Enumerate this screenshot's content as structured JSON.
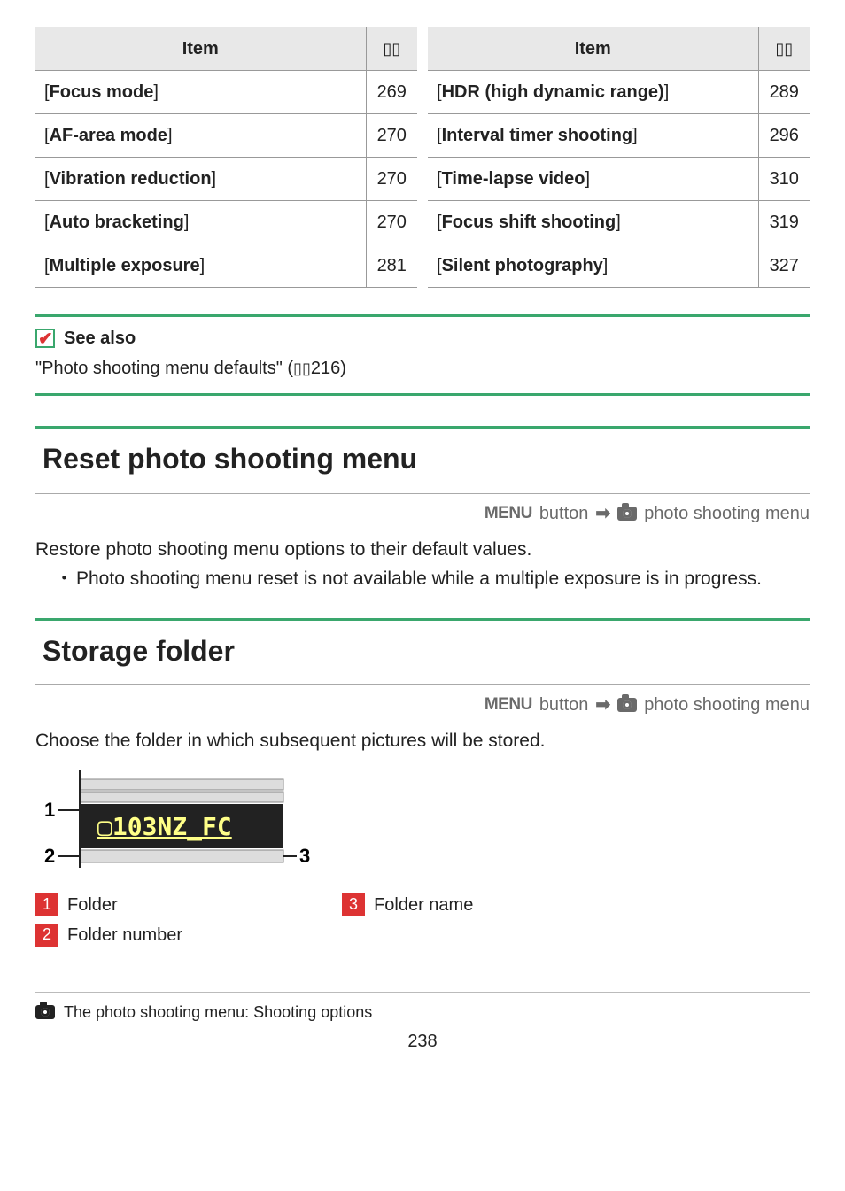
{
  "tables": {
    "header_item": "Item",
    "left": [
      {
        "label": "Focus mode",
        "page": "269"
      },
      {
        "label": "AF-area mode",
        "page": "270"
      },
      {
        "label": "Vibration reduction",
        "page": "270"
      },
      {
        "label": "Auto bracketing",
        "page": "270"
      },
      {
        "label": "Multiple exposure",
        "page": "281"
      }
    ],
    "right": [
      {
        "label": "HDR (high dynamic range)",
        "page": "289"
      },
      {
        "label": "Interval timer shooting",
        "page": "296"
      },
      {
        "label": "Time-lapse video",
        "page": "310"
      },
      {
        "label": "Focus shift shooting",
        "page": "319"
      },
      {
        "label": "Silent photography",
        "page": "327"
      }
    ]
  },
  "see_also": {
    "title": "See also",
    "text_prefix": "\"Photo shooting menu defaults\" (",
    "text_page": "216",
    "text_suffix": ")"
  },
  "section1": {
    "heading": "Reset photo shooting menu",
    "breadcrumb_menu": "MENU",
    "breadcrumb_button": " button ",
    "breadcrumb_dest": " photo shooting menu",
    "body": "Restore photo shooting menu options to their default values.",
    "bullet": "Photo shooting menu reset is not available while a multiple exposure is in progress."
  },
  "section2": {
    "heading": "Storage folder",
    "breadcrumb_menu": "MENU",
    "breadcrumb_button": " button ",
    "breadcrumb_dest": " photo shooting menu",
    "body": "Choose the folder in which subsequent pictures will be stored.",
    "diagram_folder_text": "103NZ_FC",
    "callouts": [
      {
        "num": "1",
        "label": "Folder"
      },
      {
        "num": "2",
        "label": "Folder number"
      },
      {
        "num": "3",
        "label": "Folder name"
      }
    ]
  },
  "footer": {
    "title": "The photo shooting menu: Shooting options",
    "page": "238"
  }
}
